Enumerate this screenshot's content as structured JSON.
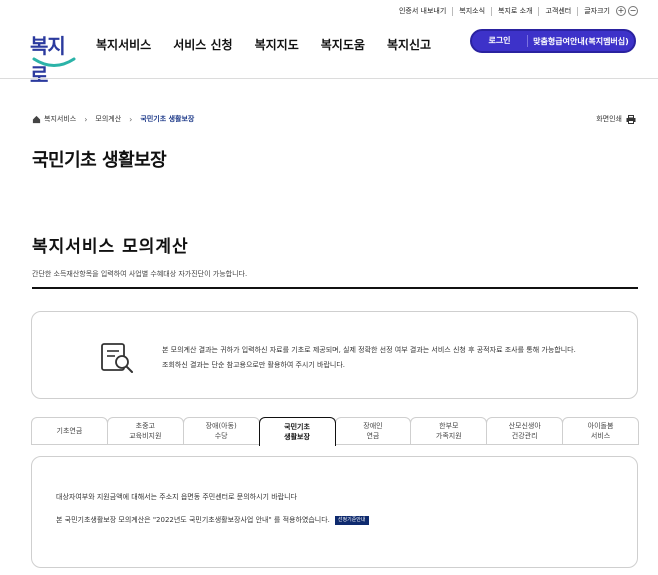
{
  "util_bar": {
    "links": [
      "인증서 내보내기",
      "복지소식",
      "복지로 소개",
      "고객센터"
    ],
    "zoom_label": "글자크기",
    "zoom_in": "+",
    "zoom_out": "−"
  },
  "logo": {
    "text": "복지로"
  },
  "gnb": [
    "복지서비스",
    "서비스 신청",
    "복지지도",
    "복지도움",
    "복지신고"
  ],
  "header_buttons": {
    "login": "로그인",
    "guide": "맞춤형급여안내(복지멤버십)"
  },
  "breadcrumb": {
    "items": [
      "복지서비스",
      "모의계산",
      "국민기초 생활보장"
    ],
    "sep": "›"
  },
  "print_label": "화면인쇄",
  "page_title": "국민기초 생활보장",
  "section": {
    "title": "복지서비스 모의계산",
    "desc": "간단한 소득재산항목을 입력하여 사업별 수혜대상 자가진단이 가능합니다."
  },
  "notice": {
    "text": "본 모의계산 결과는 귀하가 입력하신 자료를 기초로 제공되며, 실제 정확한 선정 여부 결과는 서비스 신청 후 공적자료 조사를 통해 가능합니다. 조회하신 결과는 단순 참고용으로만 활용하여 주시기 바랍니다."
  },
  "tabs": [
    {
      "label": "기초연금",
      "active": false
    },
    {
      "label": "초중고\n교육비지원",
      "active": false
    },
    {
      "label": "장애(아동)\n수당",
      "active": false
    },
    {
      "label": "국민기초\n생활보장",
      "active": true
    },
    {
      "label": "장애인\n연금",
      "active": false
    },
    {
      "label": "한부모\n가족지원",
      "active": false
    },
    {
      "label": "산모신생아\n건강관리",
      "active": false
    },
    {
      "label": "아이돌봄\n서비스",
      "active": false
    }
  ],
  "content": {
    "line1": "대상자여부와 지원금액에 대해서는 주소지 읍면동 주민센터로 문의하시기 바랍니다",
    "line2": "본 국민기초생활보장 모의계산은 \"2022년도 국민기초생활보장사업 안내\" 를 적용하였습니다.",
    "badge": "선정기준안내"
  },
  "colors": {
    "brand": "#3d32c9",
    "logo": "#2b3a9e",
    "breadcrumb_current": "#1f3b8a"
  }
}
